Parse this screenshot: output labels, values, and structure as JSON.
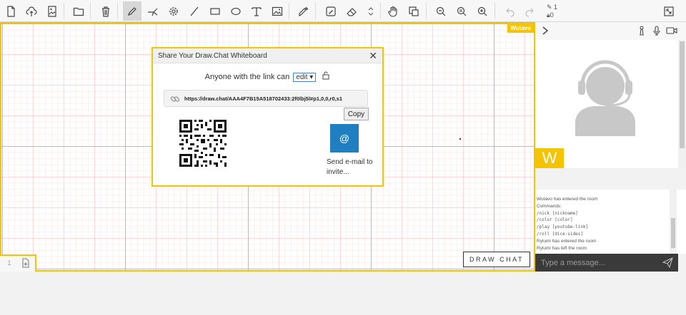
{
  "toolbar": {
    "stats": {
      "pen_count": "1",
      "lock_count": "0"
    },
    "tools": [
      "new-file",
      "cloud-upload",
      "image-file",
      "open-folder",
      "trash",
      "pencil",
      "laser-pointer",
      "gear",
      "line",
      "rectangle",
      "ellipse",
      "text",
      "image",
      "eyedropper",
      "color-fill",
      "eraser",
      "size-stepper",
      "hand",
      "replace",
      "zoom-out",
      "zoom-reset",
      "zoom-in",
      "undo",
      "redo"
    ],
    "active_tool": "pencil"
  },
  "canvas": {
    "owner_tag": "Wutavo",
    "page_number": "1",
    "logo_text": "DRAW CHAT"
  },
  "dialog": {
    "title": "Share Your Draw.Chat Whiteboard",
    "close_label": "✕",
    "permission_prefix": "Anyone with the link can",
    "permission_value": "edit",
    "link_url": "https://draw.chat/AAA4F7B15A518702433:2f0lbj5l#p1,0,0,r0,s1",
    "copy_label": "Copy",
    "email_icon": "@",
    "email_label": "Send e-mail to invite..."
  },
  "panel": {
    "user_initial": "W",
    "chat_log": [
      {
        "text": "Wutavo has entered the room",
        "mono": false
      },
      {
        "text": "Commands:",
        "mono": false
      },
      {
        "text": "/nick [nickname]",
        "mono": true
      },
      {
        "text": "/color [color]",
        "mono": true
      },
      {
        "text": "/play [youtube-link]",
        "mono": true
      },
      {
        "text": "/roll [dice-sides]",
        "mono": true
      },
      {
        "text": "Rylumi has entered the room",
        "mono": false
      },
      {
        "text": "Rylumi has left the room",
        "mono": false
      }
    ],
    "message_placeholder": "Type a message..."
  },
  "colors": {
    "accent": "#f4c400",
    "email_button": "#1f7fc1",
    "message_bar": "#3a3a3a"
  }
}
